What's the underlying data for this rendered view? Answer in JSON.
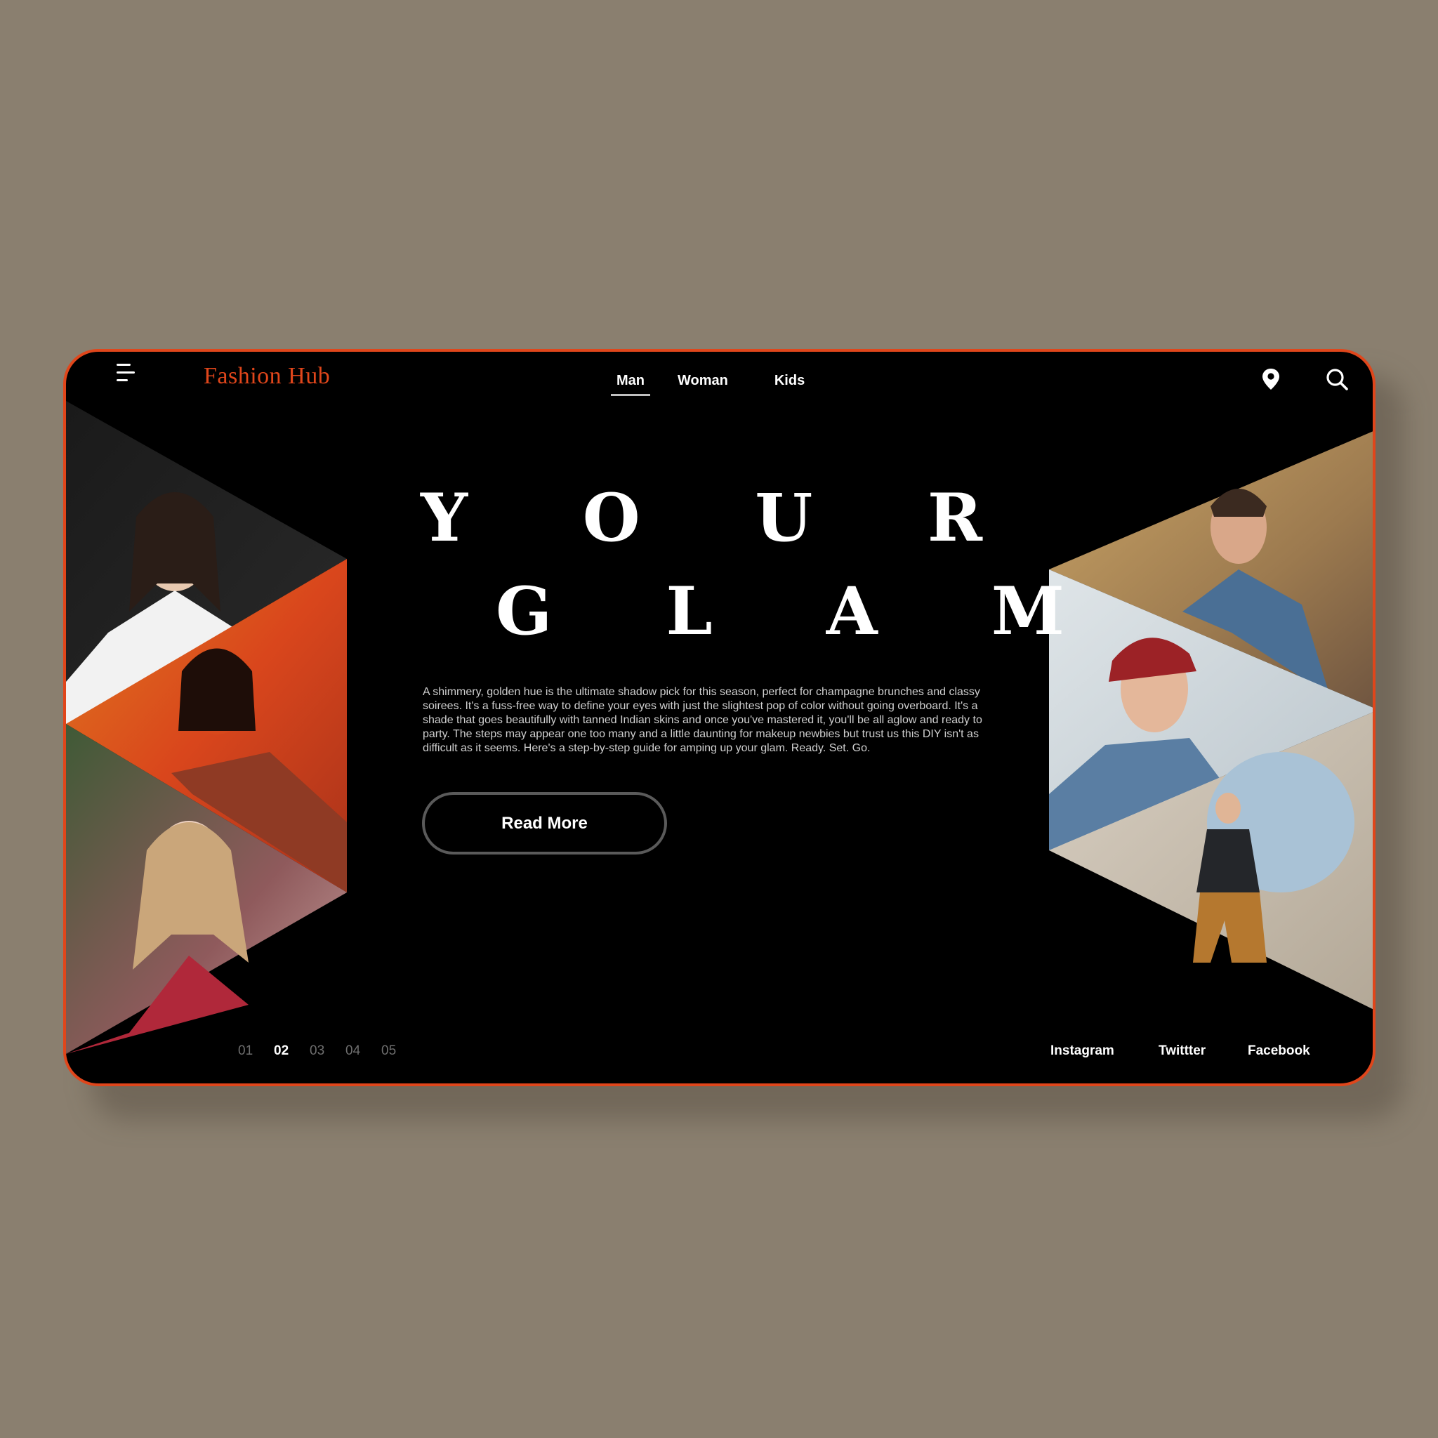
{
  "brand": {
    "name": "Fashion Hub",
    "accent_color": "#e0461b"
  },
  "header": {
    "menu_icon": "hamburger-menu-icon",
    "nav": [
      {
        "label": "Man",
        "active": true
      },
      {
        "label": "Woman",
        "active": false
      },
      {
        "label": "Kids",
        "active": false
      }
    ],
    "icons": [
      "location-pin-icon",
      "search-icon"
    ]
  },
  "hero": {
    "title_line1": [
      "Y",
      "O",
      "U",
      "R"
    ],
    "title_line2": [
      "G",
      "L",
      "A",
      "M"
    ],
    "description": "A shimmery, golden hue is the ultimate shadow pick for this season, perfect for champagne brunches and classy soirees. It's a fuss-free way to define your eyes with just the slightest pop of color without going overboard. It's a shade that goes beautifully with tanned Indian skins and once you've mastered it, you'll be all aglow and ready to party. The steps may appear one too many and a little daunting for makeup newbies but trust us this DIY isn't as difficult as it seems. Here's a step-by-step guide for amping up your glam. Ready. Set. Go.",
    "cta_label": "Read More"
  },
  "pager": {
    "pages": [
      "01",
      "02",
      "03",
      "04",
      "05"
    ],
    "active": "02"
  },
  "social": {
    "instagram": "Instagram",
    "twitter": "Twittter",
    "facebook": "Facebook"
  },
  "colors": {
    "page_background": "#8a7f6f",
    "card_background": "#000000",
    "card_border": "#e0461b",
    "text_primary": "#ffffff",
    "text_muted": "#6e6e6e"
  }
}
